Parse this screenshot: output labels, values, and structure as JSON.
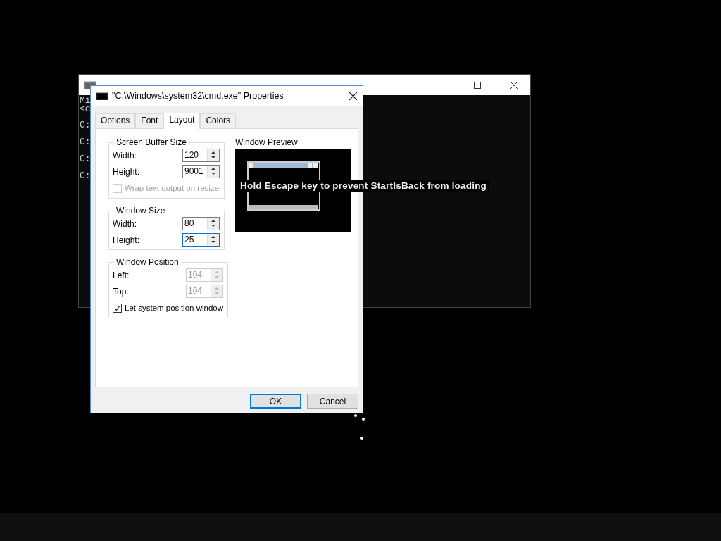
{
  "background_window": {
    "console_lines": [
      "Mi",
      "<c",
      "C:",
      "C:",
      "C:",
      "C:"
    ]
  },
  "dialog": {
    "title": "\"C:\\Windows\\system32\\cmd.exe\" Properties",
    "tabs": [
      {
        "label": "Options",
        "selected": false
      },
      {
        "label": "Font",
        "selected": false
      },
      {
        "label": "Layout",
        "selected": true
      },
      {
        "label": "Colors",
        "selected": false
      }
    ],
    "groups": [
      {
        "title": "Screen Buffer Size",
        "fields": [
          {
            "label": "Width:",
            "value": "120",
            "disabled": false,
            "focused": false
          },
          {
            "label": "Height:",
            "value": "9001",
            "disabled": false,
            "focused": false
          }
        ],
        "checkbox": {
          "label": "Wrap text output on resize",
          "checked": false,
          "disabled": true
        }
      },
      {
        "title": "Window Size",
        "fields": [
          {
            "label": "Width:",
            "value": "80",
            "disabled": false,
            "focused": false
          },
          {
            "label": "Height:",
            "value": "25",
            "disabled": false,
            "focused": true
          }
        ]
      },
      {
        "title": "Window Position",
        "fields": [
          {
            "label": "Left:",
            "value": "104",
            "disabled": true,
            "focused": false
          },
          {
            "label": "Top:",
            "value": "104",
            "disabled": true,
            "focused": false
          }
        ],
        "checkbox": {
          "label": "Let system position window",
          "checked": true,
          "disabled": false
        }
      }
    ],
    "preview": {
      "label": "Window Preview"
    },
    "buttons": [
      {
        "label": "OK",
        "default": true
      },
      {
        "label": "Cancel",
        "default": false
      }
    ]
  },
  "overlay_message": "Hold Escape key to prevent StartIsBack from loading"
}
